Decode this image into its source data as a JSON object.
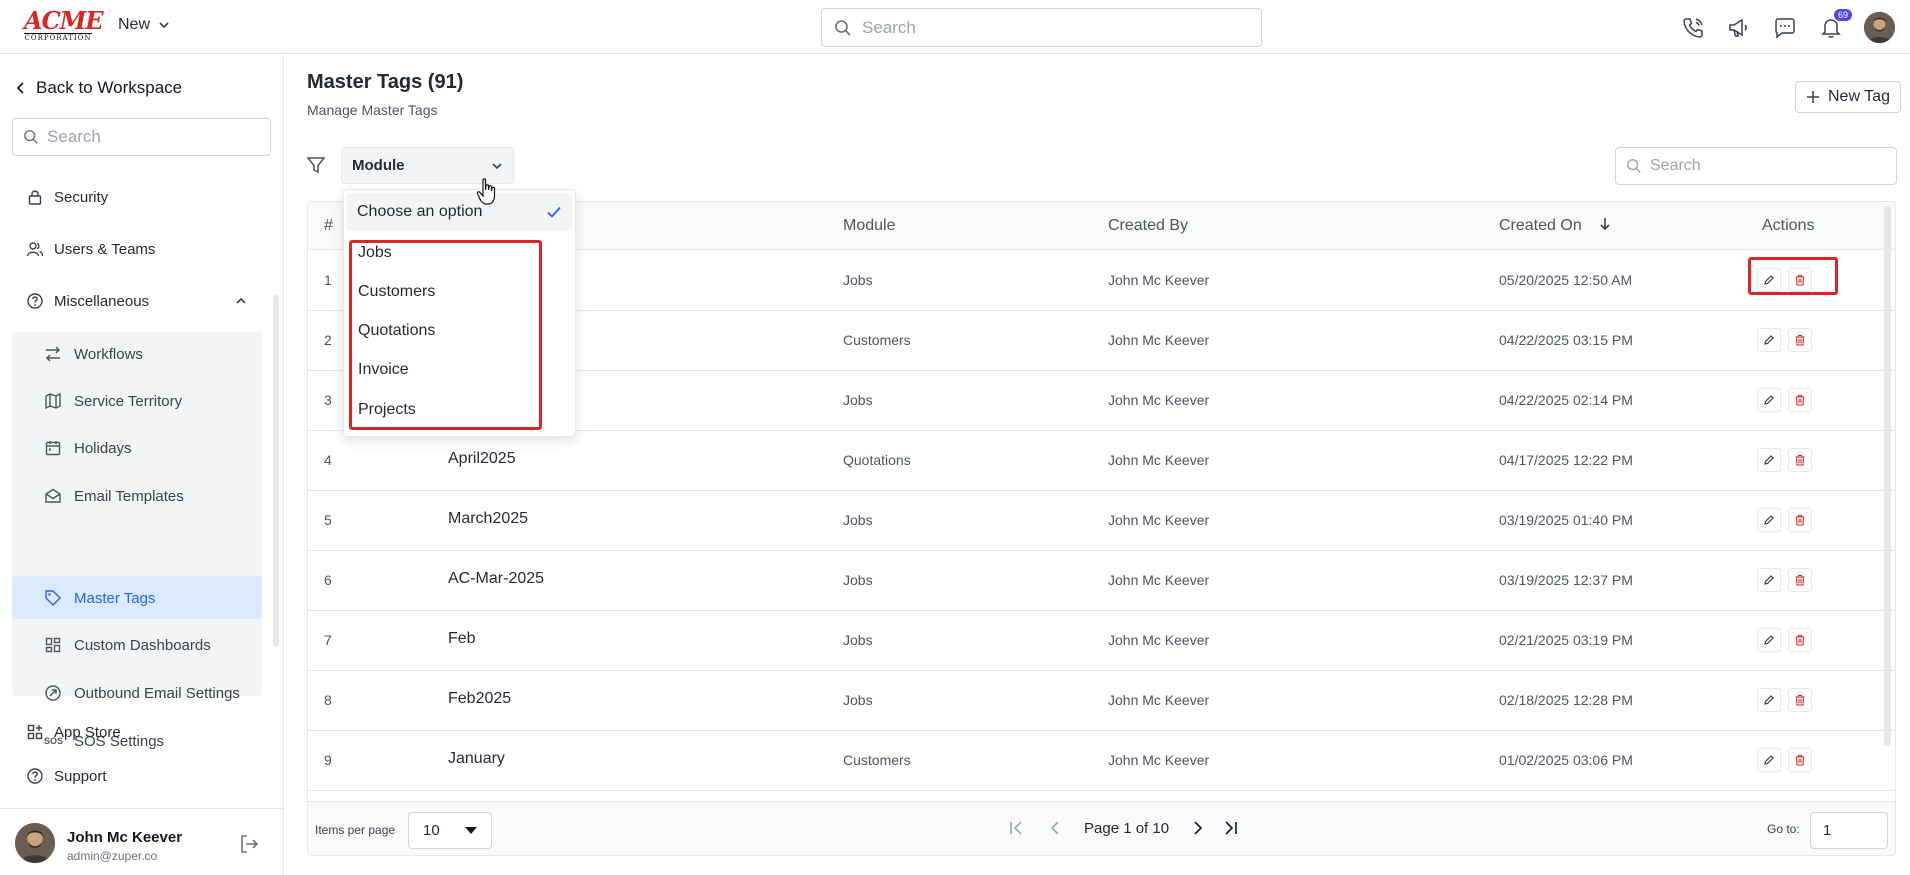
{
  "topbar": {
    "logo_line1": "ACME",
    "logo_line2": "CORPORATION",
    "new_label": "New",
    "search_placeholder": "Search",
    "notification_count": "69",
    "icons": [
      "phone-icon",
      "megaphone-icon",
      "chat-icon",
      "bell-icon",
      "avatar"
    ]
  },
  "sidebar": {
    "back_label": "Back to Workspace",
    "search_placeholder": "Search",
    "items": [
      {
        "label": "Security",
        "icon": "lock-icon"
      },
      {
        "label": "Users & Teams",
        "icon": "users-icon"
      },
      {
        "label": "Miscellaneous",
        "icon": "question-icon",
        "expanded": true
      }
    ],
    "sub_items": [
      {
        "label": "Workflows",
        "icon": "arrows-icon"
      },
      {
        "label": "Service Territory",
        "icon": "map-icon"
      },
      {
        "label": "Holidays",
        "icon": "calendar-icon"
      },
      {
        "label": "Email Templates",
        "icon": "mail-icon"
      },
      {
        "label": "Master Tags",
        "icon": "tag-icon",
        "active": true
      },
      {
        "label": "Custom Dashboards",
        "icon": "dashboard-icon"
      },
      {
        "label": "Outbound Email Settings",
        "icon": "send-icon"
      },
      {
        "label": "SOS Settings",
        "icon": "sos-icon",
        "icon_text": "SOS"
      }
    ],
    "bottom_items": [
      {
        "label": "App Store",
        "icon": "apps-icon"
      },
      {
        "label": "Support",
        "icon": "help-icon"
      }
    ],
    "user": {
      "name": "John Mc Keever",
      "email": "admin@zuper.co"
    }
  },
  "main": {
    "title": "Master Tags (91)",
    "subtitle": "Manage Master Tags",
    "new_tag_label": "New Tag",
    "module_select": "Module",
    "search_placeholder": "Search",
    "columns": [
      "#",
      "Module",
      "Created By",
      "Created On",
      "Actions"
    ],
    "rows": [
      {
        "num": "1",
        "name": "",
        "module": "Jobs",
        "created_by": "John Mc Keever",
        "created_on": "05/20/2025 12:50 AM"
      },
      {
        "num": "2",
        "name": "",
        "module": "Customers",
        "created_by": "John Mc Keever",
        "created_on": "04/22/2025 03:15 PM"
      },
      {
        "num": "3",
        "name": "",
        "module": "Jobs",
        "created_by": "John Mc Keever",
        "created_on": "04/22/2025 02:14 PM"
      },
      {
        "num": "4",
        "name": "April2025",
        "module": "Quotations",
        "created_by": "John Mc Keever",
        "created_on": "04/17/2025 12:22 PM"
      },
      {
        "num": "5",
        "name": "March2025",
        "module": "Jobs",
        "created_by": "John Mc Keever",
        "created_on": "03/19/2025 01:40 PM"
      },
      {
        "num": "6",
        "name": "AC-Mar-2025",
        "module": "Jobs",
        "created_by": "John Mc Keever",
        "created_on": "03/19/2025 12:37 PM"
      },
      {
        "num": "7",
        "name": "Feb",
        "module": "Jobs",
        "created_by": "John Mc Keever",
        "created_on": "02/21/2025 03:19 PM"
      },
      {
        "num": "8",
        "name": "Feb2025",
        "module": "Jobs",
        "created_by": "John Mc Keever",
        "created_on": "02/18/2025 12:28 PM"
      },
      {
        "num": "9",
        "name": "January",
        "module": "Customers",
        "created_by": "John Mc Keever",
        "created_on": "01/02/2025 03:06 PM"
      }
    ],
    "footer": {
      "items_per_page_label": "Items per page",
      "items_per_page": "10",
      "page_text": "Page 1 of 10",
      "goto_label": "Go to:",
      "goto_value": "1"
    }
  },
  "dropdown": {
    "chosen": "Choose an option",
    "options": [
      "Jobs",
      "Customers",
      "Quotations",
      "Invoice",
      "Projects"
    ]
  },
  "colors": {
    "accent": "#2563eb",
    "active_bg": "#dbeafe",
    "danger": "#dc2626",
    "badge": "#4f46e5"
  }
}
